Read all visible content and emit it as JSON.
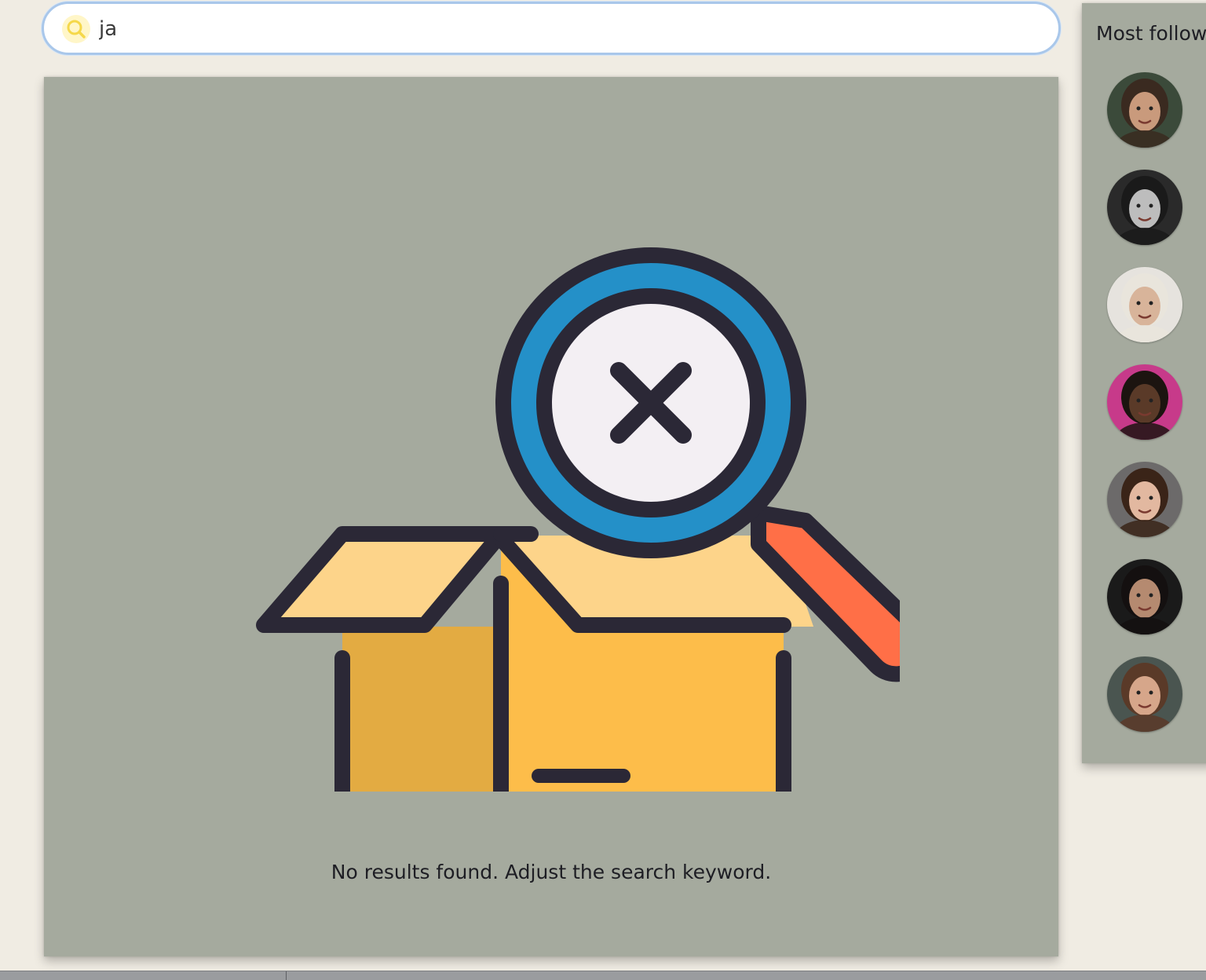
{
  "search": {
    "value": "ja",
    "icon": "search-icon"
  },
  "results": {
    "empty_message": "No results found. Adjust the search keyword.",
    "illustration": "empty-box-with-magnifier-icon"
  },
  "sidebar": {
    "title": "Most follow",
    "users": [
      {
        "avatar": "avatar-1",
        "bg": "#3b4a3a",
        "skin": "#c99a7c",
        "hair": "#3a2a20"
      },
      {
        "avatar": "avatar-2",
        "bg": "#2a2a2a",
        "skin": "#bdbdbd",
        "hair": "#1a1a1a"
      },
      {
        "avatar": "avatar-3",
        "bg": "#e6e3de",
        "skin": "#d8b49a",
        "hair": "#e9e5dc"
      },
      {
        "avatar": "avatar-4",
        "bg": "#c73a8a",
        "skin": "#5a3a28",
        "hair": "#1c1410"
      },
      {
        "avatar": "avatar-5",
        "bg": "#6c6a6a",
        "skin": "#e2b8a0",
        "hair": "#3a2418"
      },
      {
        "avatar": "avatar-6",
        "bg": "#1a1a1a",
        "skin": "#b58a70",
        "hair": "#141010"
      },
      {
        "avatar": "avatar-7",
        "bg": "#4a5550",
        "skin": "#d6a68a",
        "hair": "#5a3a28"
      }
    ]
  },
  "colors": {
    "panel": "#a5aa9e",
    "page": "#f0ece3",
    "outline": "#2b2836",
    "lens_ring": "#2490c8",
    "lens_glass": "#f3eff3",
    "handle": "#ff6f47",
    "box_front": "#fdbd4a",
    "box_side": "#e3ab42",
    "box_flap": "#fdd48a"
  }
}
